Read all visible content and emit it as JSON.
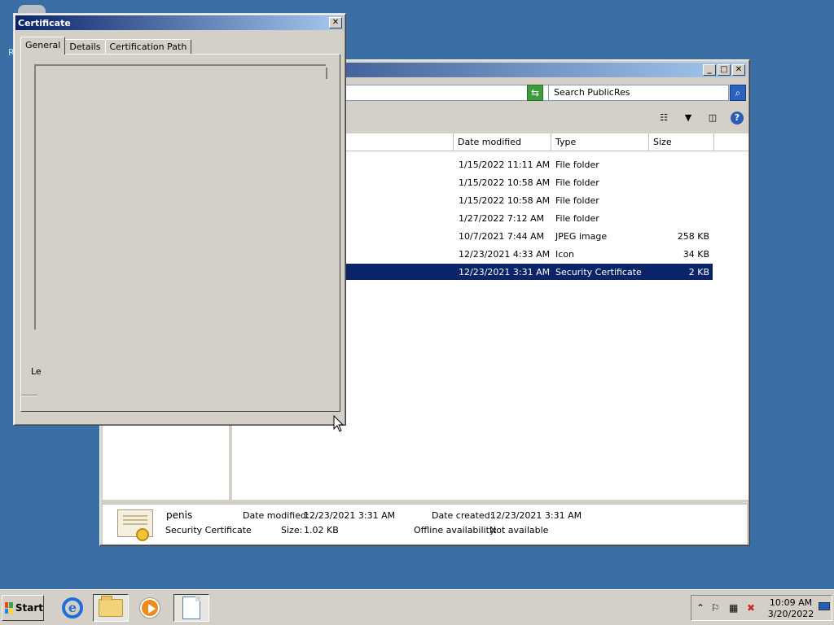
{
  "desktop": {
    "edge_letter": "R"
  },
  "explorer": {
    "window_controls": {
      "minimize": "_",
      "maximize": "□",
      "close": "✕"
    },
    "search": {
      "placeholder": "Search PublicRes"
    },
    "columns": [
      {
        "label": "Date modified"
      },
      {
        "label": "Type"
      },
      {
        "label": "Size"
      }
    ],
    "rows": [
      {
        "date": "1/15/2022 11:11 AM",
        "type": "File folder",
        "size": "",
        "selected": false
      },
      {
        "date": "1/15/2022 10:58 AM",
        "type": "File folder",
        "size": "",
        "selected": false
      },
      {
        "date": "1/15/2022 10:58 AM",
        "type": "File folder",
        "size": "",
        "selected": false
      },
      {
        "date": "1/27/2022 7:12 AM",
        "type": "File folder",
        "size": "",
        "selected": false
      },
      {
        "date": "10/7/2021 7:44 AM",
        "type": "JPEG image",
        "size": "258 KB",
        "selected": false
      },
      {
        "date": "12/23/2021 4:33 AM",
        "type": "Icon",
        "size": "34 KB",
        "selected": false
      },
      {
        "date": "12/23/2021 3:31 AM",
        "type": "Security Certificate",
        "size": "2 KB",
        "selected": true
      }
    ],
    "details": {
      "name": "penis",
      "type": "Security Certificate",
      "date_modified_label": "Date modified:",
      "date_modified": "12/23/2021 3:31 AM",
      "size_label": "Size:",
      "size": "1.02 KB",
      "date_created_label": "Date created:",
      "date_created": "12/23/2021 3:31 AM",
      "offline_label": "Offline availability:",
      "offline": "Not available"
    }
  },
  "certificate_dialog": {
    "title": "Certificate",
    "close": "✕",
    "tabs": [
      {
        "label": "General",
        "active": true
      },
      {
        "label": "Details",
        "active": false
      },
      {
        "label": "Certification Path",
        "active": false
      }
    ],
    "truncated_label": "Le"
  },
  "taskbar": {
    "start_label": "Start",
    "apps": [
      "internet-explorer",
      "windows-explorer",
      "media-player",
      "certificate-document"
    ],
    "clock": {
      "time": "10:09 AM",
      "date": "3/20/2022"
    }
  }
}
